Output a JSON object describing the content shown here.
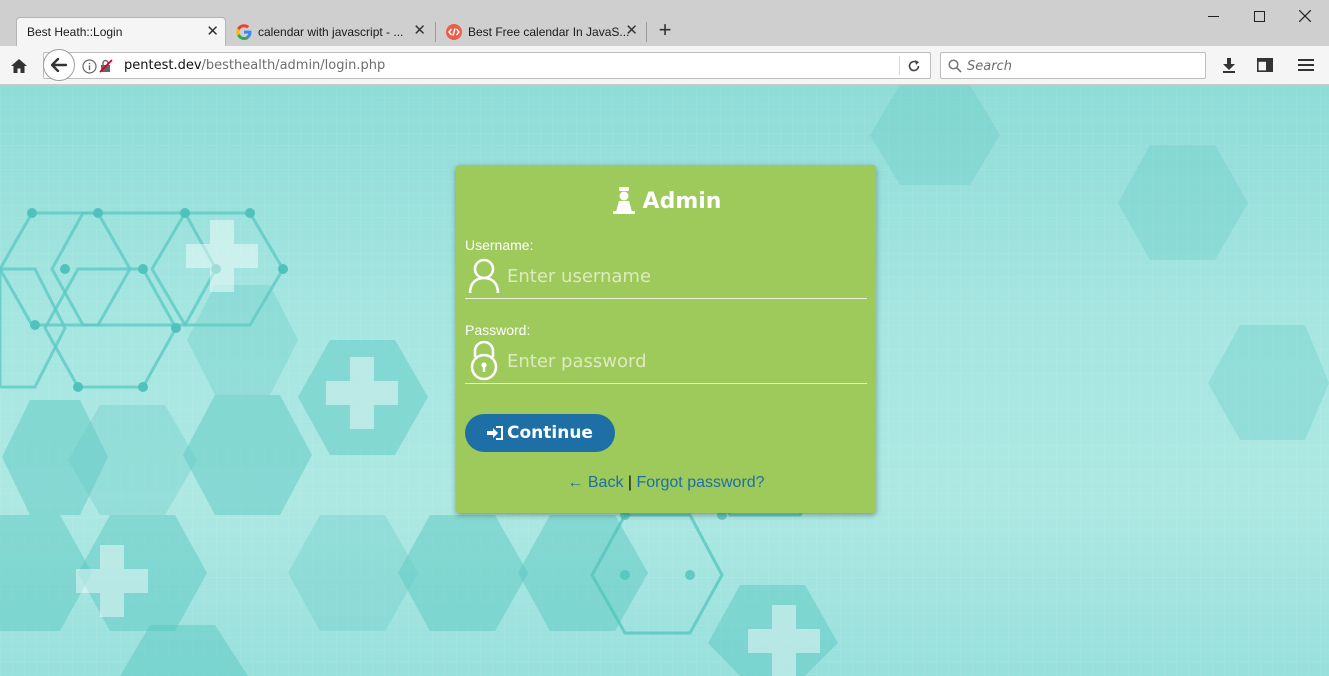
{
  "browser": {
    "tabs": [
      {
        "title": "Best Heath::Login",
        "active": true
      },
      {
        "title": "calendar with javascript - ...",
        "active": false,
        "favicon": "google-icon"
      },
      {
        "title": "Best Free calendar In JavaS...",
        "active": false,
        "favicon": "code-icon"
      }
    ],
    "url": {
      "host": "pentest.dev",
      "path": "/besthealth/admin/login.php"
    },
    "search_placeholder": "Search"
  },
  "login": {
    "title": "Admin",
    "username_label": "Username:",
    "username_placeholder": "Enter username",
    "username_value": "",
    "password_label": "Password:",
    "password_placeholder": "Enter password",
    "password_value": "",
    "continue_label": "Continue",
    "back_label": "← Back",
    "separator": "|",
    "forgot_label": "Forgot password?"
  },
  "colors": {
    "card_bg": "#9ec95b",
    "button_bg": "#1e6fa5",
    "link": "#1e6fa5",
    "page_bg": "#a6e6e1"
  }
}
